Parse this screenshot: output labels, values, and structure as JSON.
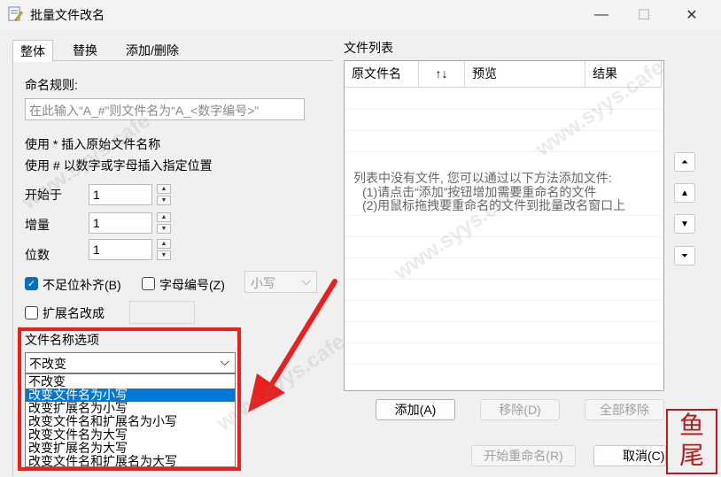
{
  "window": {
    "title": "批量文件改名",
    "minimize": "—",
    "maximize": "☐",
    "close": "✕"
  },
  "tabs": [
    {
      "label": "整体",
      "active": true
    },
    {
      "label": "替换",
      "active": false
    },
    {
      "label": "添加/删除",
      "active": false
    }
  ],
  "rule": {
    "label": "命名规则:",
    "placeholder": "在此输入“A_#”则文件名为“A_<数字编号>”",
    "help1": "使用 * 插入原始文件名称",
    "help2": "使用 # 以数字或字母插入指定位置"
  },
  "fields": {
    "start_label": "开始于",
    "start_value": "1",
    "step_label": "增量",
    "step_value": "1",
    "digits_label": "位数",
    "digits_value": "1",
    "spin_up": "▲",
    "spin_down": "▼"
  },
  "options": {
    "pad_label": "不足位补齐(B)",
    "pad_checked": true,
    "letter_label": "字母编号(Z)",
    "letter_checked": false,
    "case_select": "小写",
    "ext_label": "扩展名改成",
    "ext_checked": false,
    "check_mark": "✓",
    "chevron": "⌵"
  },
  "name_options": {
    "label": "文件名称选项",
    "selected": "不改变",
    "items": [
      "不改变",
      "改变文件名为小写",
      "改变扩展名为小写",
      "改变文件名和扩展名为小写",
      "改变文件名为大写",
      "改变扩展名为大写",
      "改变文件名和扩展名为大写"
    ],
    "highlighted_index": 1
  },
  "file_list": {
    "label": "文件列表",
    "columns": [
      "原文件名",
      "↑↓",
      "预览",
      "结果"
    ],
    "empty_hint1": "列表中没有文件, 您可以通过以下方法添加文件:",
    "empty_hint2": "(1)请点击“添加”按钮增加需要重命名的文件",
    "empty_hint3": "(2)用鼠标拖拽要重命名的文件到批量改名窗口上"
  },
  "side_buttons": [
    "⏶",
    "▲",
    "▼",
    "⏷"
  ],
  "buttons": {
    "add": "添加(A)",
    "remove": "移除(D)",
    "remove_all": "全部移除",
    "start": "开始重命名(R)",
    "cancel": "取消(C)"
  },
  "watermark": "www.syys.cafe",
  "seal": "鱼尾"
}
